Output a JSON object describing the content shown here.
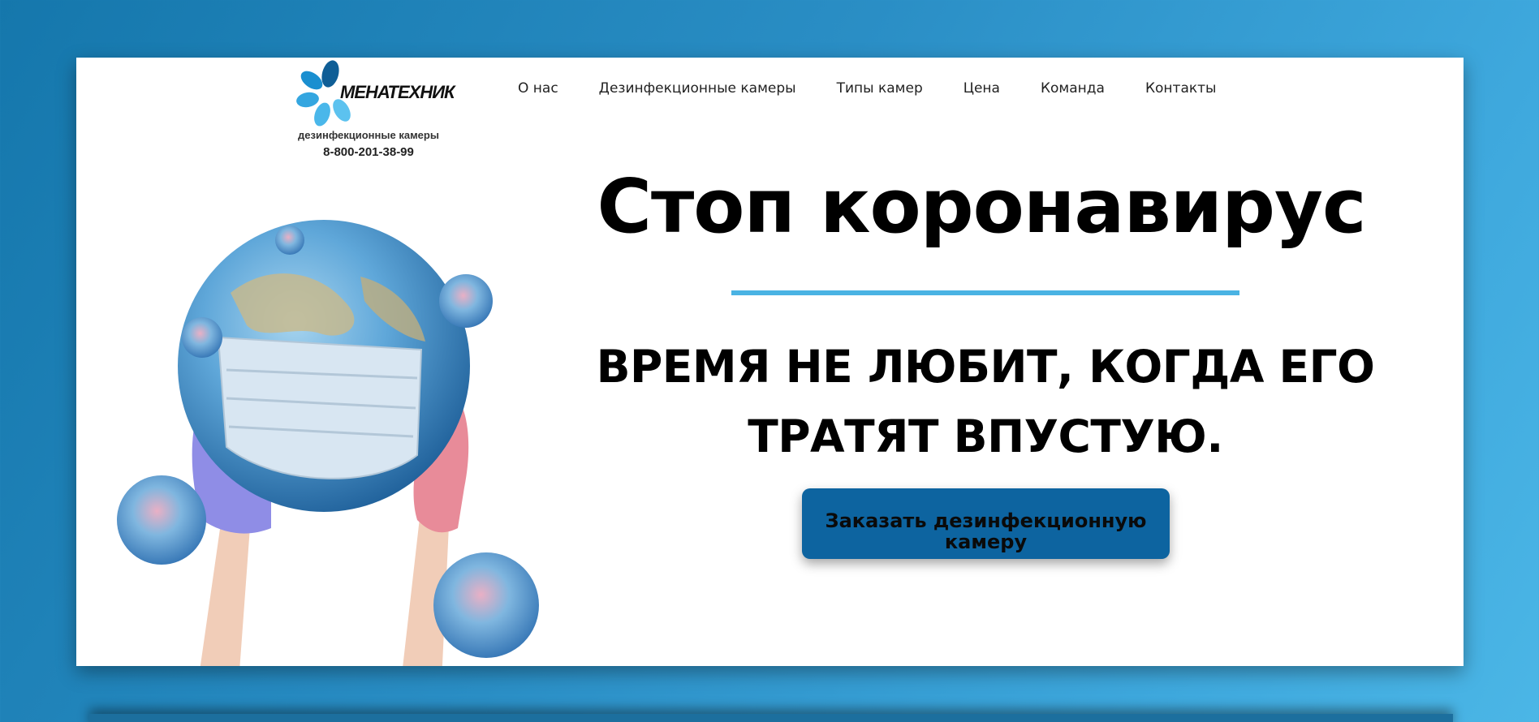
{
  "logo": {
    "name": "МЕНАТЕХНИК",
    "tagline": "дезинфекционные камеры",
    "phone": "8-800-201-38-99"
  },
  "nav": [
    {
      "label": "О нас"
    },
    {
      "label": "Дезинфекционные камеры"
    },
    {
      "label": "Типы камер"
    },
    {
      "label": "Цена"
    },
    {
      "label": "Команда"
    },
    {
      "label": "Контакты"
    }
  ],
  "hero": {
    "title": "Стоп коронавирус",
    "subtitle": "ВРЕМЯ НЕ ЛЮБИТ, КОГДА ЕГО ТРАТЯТ ВПУСТУЮ.",
    "cta_label": "Заказать дезинфекционную камеру"
  },
  "colors": {
    "background": "#2a8ec5",
    "accent_line": "#4ab3e3",
    "cta_background": "#0d64a0"
  },
  "icons": [
    "logo-petals-icon",
    "globe-with-mask-image",
    "virus-icon"
  ]
}
